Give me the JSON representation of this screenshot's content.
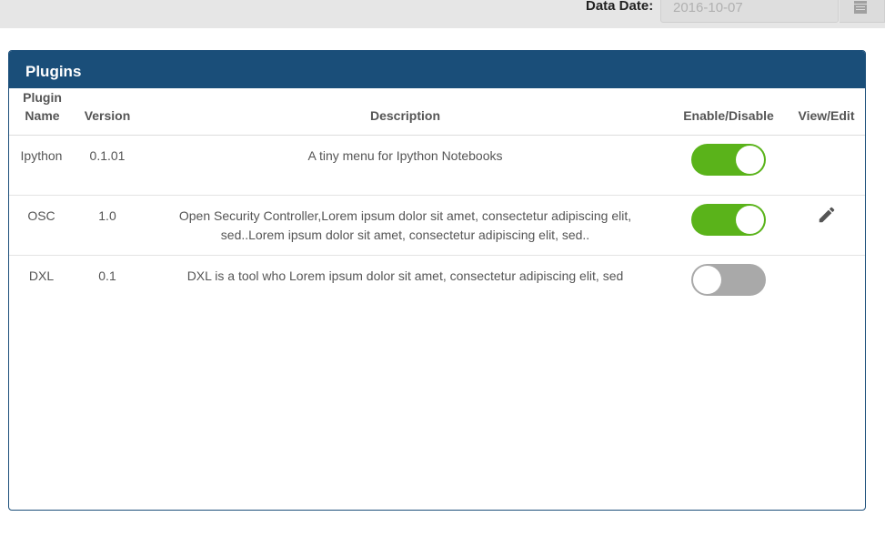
{
  "topbar": {
    "date_label": "Data Date:",
    "date_value": "2016-10-07",
    "calendar_icon": "calendar-icon"
  },
  "panel": {
    "title": "Plugins",
    "columns": {
      "name": "Plugin Name",
      "version": "Version",
      "description": "Description",
      "enable": "Enable/Disable",
      "view_edit": "View/Edit"
    },
    "rows": [
      {
        "name": "Ipython",
        "version": "0.1.01",
        "description": "A tiny menu for Ipython Notebooks",
        "enabled": true,
        "editable": false
      },
      {
        "name": "OSC",
        "version": "1.0",
        "description": "Open Security Controller,Lorem ipsum dolor sit amet, consectetur adipiscing elit, sed..Lorem ipsum dolor sit amet, consectetur adipiscing elit, sed..",
        "enabled": true,
        "editable": true
      },
      {
        "name": "DXL",
        "version": "0.1",
        "description": "DXL is a tool who Lorem ipsum dolor sit amet, consectetur adipiscing elit, sed",
        "enabled": false,
        "editable": false
      }
    ]
  },
  "colors": {
    "header_bg": "#1a4e79",
    "toggle_on": "#5ab31a",
    "toggle_off": "#a9a9a9"
  }
}
